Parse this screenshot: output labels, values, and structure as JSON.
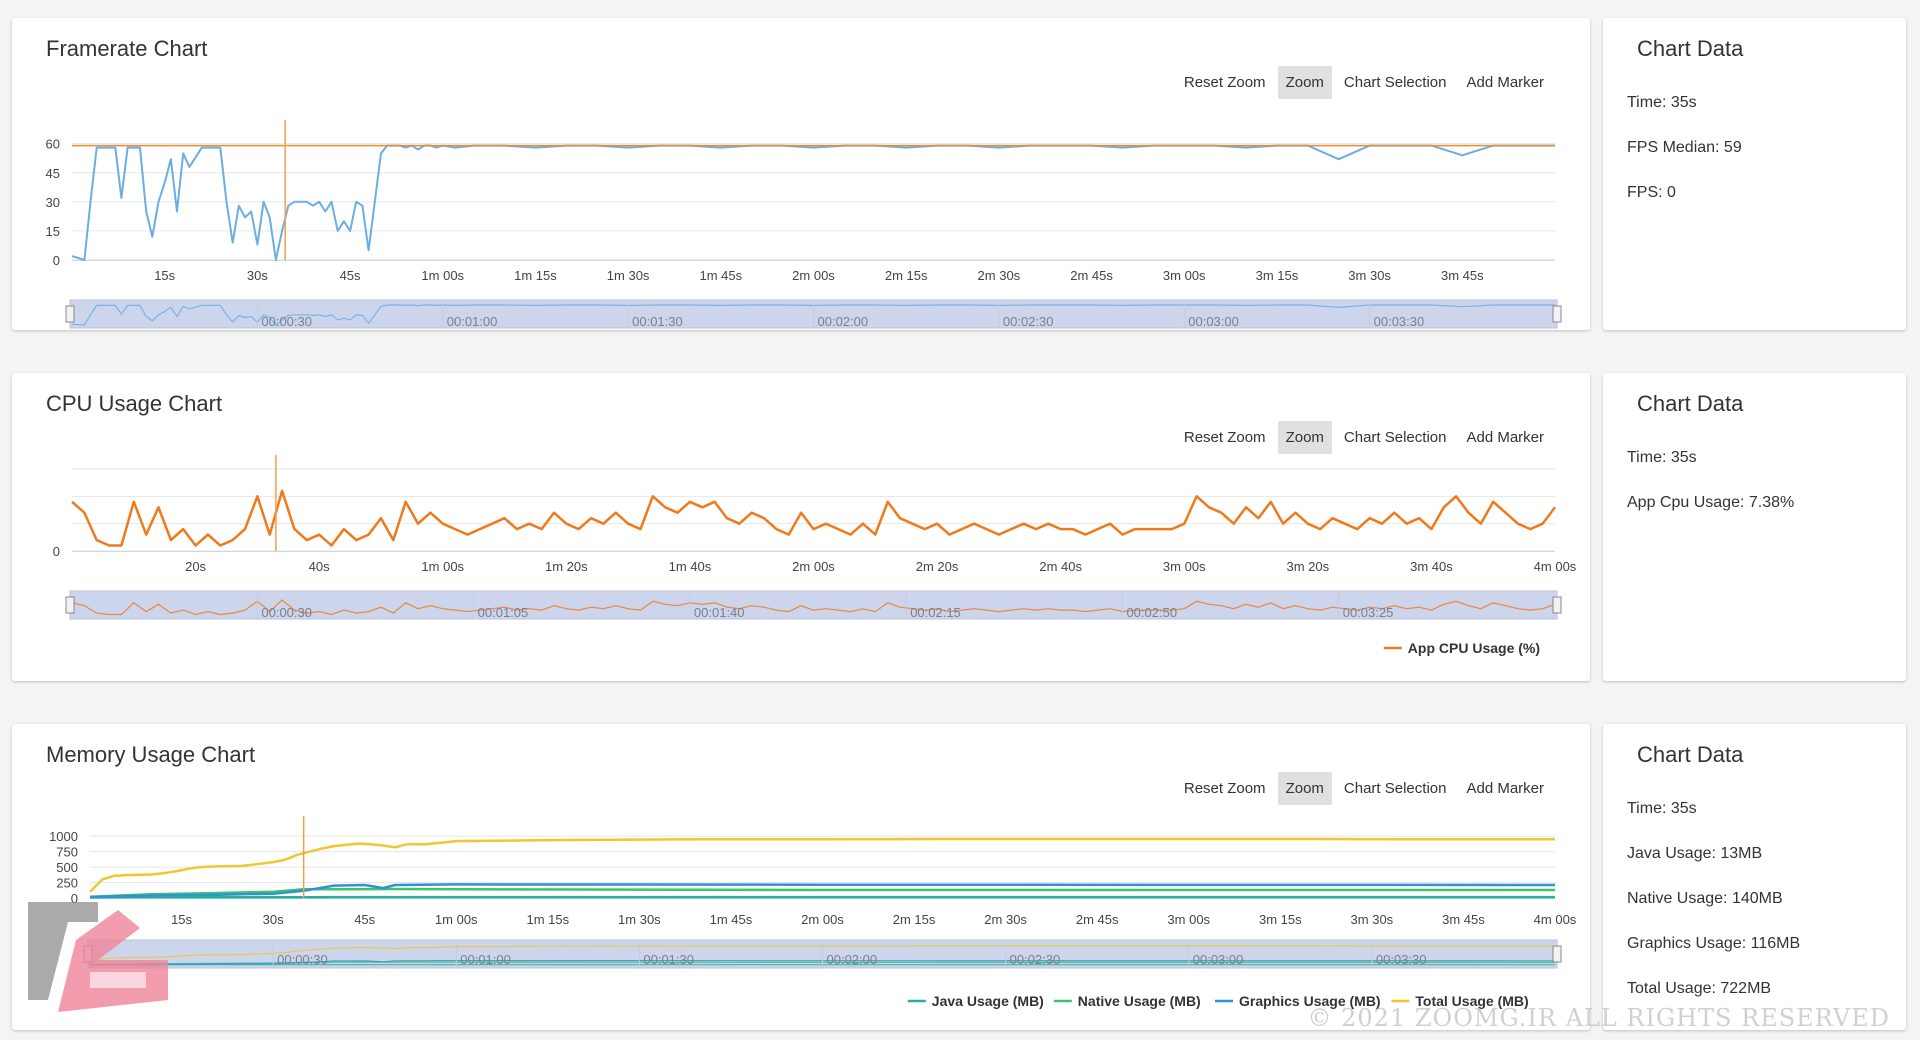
{
  "toolbar": {
    "reset_zoom": "Reset Zoom",
    "zoom": "Zoom",
    "chart_selection": "Chart Selection",
    "add_marker": "Add Marker"
  },
  "colors": {
    "fps": "#6aaee3",
    "fps_median": "#f08c28",
    "cpu": "#ee7a1c",
    "marker": "#f2a04a",
    "java": "#26b0a0",
    "native": "#3cc46a",
    "graphics": "#2f92d4",
    "total": "#efc634",
    "navigator_fill": "#cdd5ec"
  },
  "framerate": {
    "title": "Framerate Chart",
    "panel": {
      "title": "Chart Data",
      "rows": [
        "Time: 35s",
        "FPS Median: 59",
        "FPS: 0"
      ]
    }
  },
  "cpu": {
    "title": "CPU Usage Chart",
    "panel": {
      "title": "Chart Data",
      "rows": [
        "Time: 35s",
        "App Cpu Usage: 7.38%"
      ]
    }
  },
  "memory": {
    "title": "Memory Usage Chart",
    "panel": {
      "title": "Chart Data",
      "rows": [
        "Time: 35s",
        "Java Usage: 13MB",
        "Native Usage: 140MB",
        "Graphics Usage: 116MB",
        "Total Usage: 722MB"
      ]
    }
  },
  "watermark": "© 2021 ZOOMG.IR ALL RIGHTS RESERVED",
  "chart_data": [
    {
      "type": "line",
      "title": "Framerate Chart",
      "xlim": [
        0,
        240
      ],
      "ylim": [
        0,
        65
      ],
      "yticks": [
        0,
        15,
        30,
        45,
        60
      ],
      "xticks": [
        15,
        30,
        45,
        60,
        75,
        90,
        105,
        120,
        135,
        150,
        165,
        180,
        195,
        210,
        225
      ],
      "xtick_labels": [
        "15s",
        "30s",
        "45s",
        "1m 00s",
        "1m 15s",
        "1m 30s",
        "1m 45s",
        "2m 00s",
        "2m 15s",
        "2m 30s",
        "2m 45s",
        "3m 00s",
        "3m 15s",
        "3m 30s",
        "3m 45s"
      ],
      "marker_x": 34.5,
      "navigator_labels": [
        "00:00:30",
        "00:01:00",
        "00:01:30",
        "00:02:00",
        "00:02:30",
        "00:03:00",
        "00:03:30"
      ],
      "navigator_x": [
        30,
        60,
        90,
        120,
        150,
        180,
        210
      ],
      "median": 59,
      "series": [
        {
          "x": [
            0,
            2,
            3,
            4,
            5,
            6,
            7,
            8,
            9,
            10,
            11,
            12,
            13,
            14,
            15,
            16,
            17,
            18,
            19,
            20,
            21,
            22,
            23,
            24,
            25,
            26,
            27,
            28,
            29,
            30,
            31,
            32,
            33,
            34,
            35,
            36,
            37,
            38,
            39,
            40,
            41,
            42,
            43,
            44,
            45,
            46,
            47,
            48,
            49,
            50,
            51,
            52,
            53,
            54,
            55,
            56,
            57,
            58,
            59,
            60,
            62,
            65,
            70,
            75,
            80,
            85,
            90,
            95,
            100,
            105,
            110,
            115,
            120,
            125,
            130,
            135,
            140,
            145,
            150,
            155,
            160,
            165,
            170,
            175,
            180,
            185,
            190,
            195,
            200,
            205,
            210,
            215,
            220,
            225,
            230,
            235,
            240
          ],
          "y": [
            2,
            0,
            30,
            58,
            58,
            58,
            58,
            32,
            58,
            58,
            58,
            25,
            12,
            30,
            40,
            52,
            25,
            55,
            48,
            53,
            58,
            58,
            58,
            58,
            30,
            9,
            28,
            22,
            25,
            8,
            30,
            22,
            0,
            15,
            28,
            30,
            30,
            30,
            28,
            30,
            25,
            30,
            15,
            20,
            15,
            30,
            28,
            5,
            30,
            55,
            59,
            59,
            59,
            58,
            59,
            57,
            59,
            59,
            58,
            59,
            58,
            59,
            59,
            58,
            59,
            59,
            58,
            59,
            59,
            58,
            59,
            59,
            58,
            59,
            59,
            58,
            59,
            59,
            58,
            59,
            59,
            59,
            58,
            59,
            59,
            59,
            58,
            59,
            59,
            52,
            59,
            59,
            59,
            54,
            59,
            59,
            59
          ]
        }
      ]
    },
    {
      "type": "line",
      "title": "CPU Usage Chart",
      "xlim": [
        0,
        240
      ],
      "ylim": [
        0,
        15
      ],
      "yticks": [
        0
      ],
      "xticks": [
        20,
        40,
        60,
        80,
        100,
        120,
        140,
        160,
        180,
        200,
        220,
        240
      ],
      "xtick_labels": [
        "20s",
        "40s",
        "1m 00s",
        "1m 20s",
        "1m 40s",
        "2m 00s",
        "2m 20s",
        "2m 40s",
        "3m 00s",
        "3m 20s",
        "3m 40s",
        "4m 00s"
      ],
      "marker_x": 33,
      "navigator_labels": [
        "00:00:30",
        "00:01:05",
        "00:01:40",
        "00:02:15",
        "00:02:50",
        "00:03:25"
      ],
      "navigator_x": [
        30,
        65,
        100,
        135,
        170,
        205
      ],
      "series": [
        {
          "name": "App CPU Usage (%)",
          "x": [
            0,
            2,
            4,
            6,
            8,
            10,
            12,
            14,
            16,
            18,
            20,
            22,
            24,
            26,
            28,
            30,
            32,
            34,
            36,
            38,
            40,
            42,
            44,
            46,
            48,
            50,
            52,
            54,
            56,
            58,
            60,
            62,
            64,
            66,
            68,
            70,
            72,
            74,
            76,
            78,
            80,
            82,
            84,
            86,
            88,
            90,
            92,
            94,
            96,
            98,
            100,
            102,
            104,
            106,
            108,
            110,
            112,
            114,
            116,
            118,
            120,
            122,
            124,
            126,
            128,
            130,
            132,
            134,
            136,
            138,
            140,
            142,
            144,
            146,
            148,
            150,
            152,
            154,
            156,
            158,
            160,
            162,
            164,
            166,
            168,
            170,
            172,
            174,
            176,
            178,
            180,
            182,
            184,
            186,
            188,
            190,
            192,
            194,
            196,
            198,
            200,
            202,
            204,
            206,
            208,
            210,
            212,
            214,
            216,
            218,
            220,
            222,
            224,
            226,
            228,
            230,
            232,
            234,
            236,
            238,
            240
          ],
          "y": [
            9,
            7,
            2,
            1,
            1,
            9,
            3,
            8,
            2,
            4,
            1,
            3,
            1,
            2,
            4,
            10,
            3,
            11,
            4,
            2,
            3,
            1,
            4,
            2,
            3,
            6,
            2,
            9,
            5,
            7,
            5,
            4,
            3,
            4,
            5,
            6,
            4,
            5,
            4,
            7,
            5,
            4,
            6,
            5,
            7,
            5,
            4,
            10,
            8,
            7,
            9,
            8,
            9,
            6,
            5,
            7,
            6,
            4,
            3,
            7,
            4,
            5,
            4,
            3,
            5,
            3,
            9,
            6,
            5,
            4,
            5,
            3,
            4,
            5,
            4,
            3,
            4,
            5,
            4,
            5,
            4,
            4,
            3,
            4,
            5,
            3,
            4,
            4,
            4,
            4,
            5,
            10,
            8,
            7,
            5,
            8,
            6,
            9,
            5,
            7,
            5,
            4,
            6,
            5,
            4,
            6,
            5,
            7,
            5,
            6,
            4,
            8,
            10,
            7,
            5,
            9,
            7,
            5,
            4,
            5,
            8
          ]
        }
      ]
    },
    {
      "type": "line",
      "title": "Memory Usage Chart",
      "xlim": [
        0,
        240
      ],
      "ylim": [
        0,
        1100
      ],
      "yticks": [
        0,
        250,
        500,
        750,
        1000
      ],
      "xticks": [
        15,
        30,
        45,
        60,
        75,
        90,
        105,
        120,
        135,
        150,
        165,
        180,
        195,
        210,
        225,
        240
      ],
      "xtick_labels": [
        "15s",
        "30s",
        "45s",
        "1m 00s",
        "1m 15s",
        "1m 30s",
        "1m 45s",
        "2m 00s",
        "2m 15s",
        "2m 30s",
        "2m 45s",
        "3m 00s",
        "3m 15s",
        "3m 30s",
        "3m 45s",
        "4m 00s"
      ],
      "marker_x": 35,
      "navigator_labels": [
        "00:00:30",
        "00:01:00",
        "00:01:30",
        "00:02:00",
        "00:02:30",
        "00:03:00",
        "00:03:30"
      ],
      "navigator_x": [
        30,
        60,
        90,
        120,
        150,
        180,
        210
      ],
      "series": [
        {
          "name": "Java Usage (MB)",
          "x": [
            0,
            5,
            10,
            20,
            30,
            35,
            40,
            50,
            60,
            240
          ],
          "y": [
            10,
            12,
            12,
            13,
            13,
            13,
            14,
            14,
            14,
            14
          ]
        },
        {
          "name": "Native Usage (MB)",
          "x": [
            0,
            5,
            10,
            20,
            30,
            35,
            40,
            50,
            60,
            120,
            240
          ],
          "y": [
            20,
            40,
            60,
            80,
            100,
            140,
            140,
            145,
            140,
            130,
            130
          ]
        },
        {
          "name": "Graphics Usage (MB)",
          "x": [
            0,
            5,
            10,
            20,
            30,
            35,
            40,
            45,
            48,
            50,
            60,
            120,
            240
          ],
          "y": [
            10,
            30,
            40,
            50,
            70,
            116,
            200,
            210,
            160,
            210,
            220,
            215,
            210
          ]
        },
        {
          "name": "Total Usage (MB)",
          "x": [
            0,
            2,
            4,
            6,
            8,
            10,
            12,
            14,
            16,
            18,
            20,
            25,
            30,
            32,
            34,
            36,
            38,
            40,
            42,
            44,
            46,
            48,
            50,
            52,
            55,
            60,
            70,
            80,
            100,
            120,
            140,
            160,
            180,
            200,
            220,
            240
          ],
          "y": [
            100,
            300,
            360,
            370,
            375,
            380,
            400,
            430,
            470,
            500,
            510,
            520,
            580,
            620,
            700,
            750,
            800,
            840,
            860,
            880,
            870,
            850,
            820,
            870,
            870,
            920,
            930,
            940,
            950,
            950,
            955,
            955,
            955,
            955,
            950,
            950
          ]
        }
      ]
    }
  ]
}
